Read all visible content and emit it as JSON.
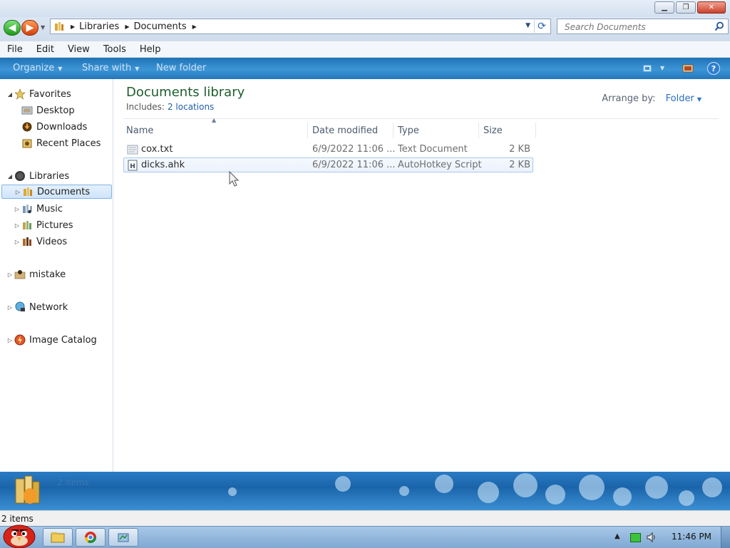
{
  "window": {
    "minimize_glyph": "▁",
    "restore_glyph": "❐",
    "close_glyph": "✕"
  },
  "address": {
    "crumbs": [
      "Libraries",
      "Documents"
    ],
    "search_placeholder": "Search Documents"
  },
  "menu": [
    "File",
    "Edit",
    "View",
    "Tools",
    "Help"
  ],
  "command_bar": {
    "organize": "Organize",
    "share_with": "Share with",
    "new_folder": "New folder",
    "help_glyph": "?"
  },
  "nav": {
    "favorites": "Favorites",
    "desktop": "Desktop",
    "downloads": "Downloads",
    "recent_places": "Recent Places",
    "libraries": "Libraries",
    "documents": "Documents",
    "music": "Music",
    "pictures": "Pictures",
    "videos": "Videos",
    "mistake": "mistake",
    "network": "Network",
    "image_catalog": "Image Catalog"
  },
  "content": {
    "title": "Documents library",
    "includes_label": "Includes:",
    "includes_link": "2 locations",
    "arrange_label": "Arrange by:",
    "arrange_value": "Folder",
    "columns": {
      "name": "Name",
      "date": "Date modified",
      "type": "Type",
      "size": "Size"
    },
    "files": [
      {
        "name": "cox.txt",
        "date": "6/9/2022 11:06 ...",
        "type": "Text Document",
        "size": "2 KB"
      },
      {
        "name": "dicks.ahk",
        "date": "6/9/2022 11:06 ...",
        "type": "AutoHotkey Script",
        "size": "2 KB"
      }
    ]
  },
  "details_pane": {
    "count": "2 items"
  },
  "status": {
    "count": "2 items"
  },
  "taskbar": {
    "time": "11:46 PM"
  },
  "colors": {
    "accent": "#1f5fae",
    "title_green": "#1e5e2c",
    "command_bar": "#2a83c8"
  }
}
